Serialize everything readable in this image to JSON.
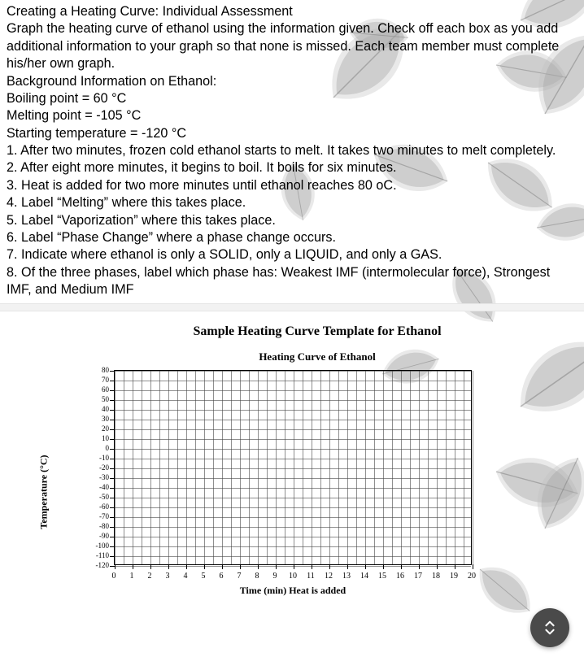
{
  "doc": {
    "title": "Creating a Heating Curve: Individual Assessment",
    "p1": "Graph the heating curve of ethanol using the information given. Check off each box as you add additional information to your graph so that none is missed. Each team member must complete his/her own graph.",
    "bg_heading": "Background Information on Ethanol:",
    "bp": "Boiling point = 60 °C",
    "mp": " Melting point = -105 °C",
    "st": " Starting temperature = -120 °C",
    "s1": "1. After two minutes, frozen cold ethanol starts to melt. It takes two minutes to melt completely.",
    "s2": "2. After eight more minutes, it begins to boil. It boils for six minutes.",
    "s3": "3. Heat is added for two more minutes until ethanol reaches 80 oC.",
    "s4": "4. Label “Melting” where this takes place.",
    "s5": "5. Label “Vaporization” where this takes place.",
    "s6": "6. Label “Phase Change” where a phase change occurs.",
    "s7": "7. Indicate where ethanol is only a SOLID, only a LIQUID, and only a GAS.",
    "s8": "8. Of the three phases, label which phase has: Weakest IMF (intermolecular force), Strongest IMF, and Medium IMF"
  },
  "chart": {
    "script_title": "Sample Heating Curve Template for Ethanol",
    "serif_title": "Heating Curve of Ethanol",
    "xlabel": "Time (min) Heat is added",
    "ylabel": "Temperature (°C)"
  },
  "chart_data": {
    "type": "line",
    "title": "Heating Curve of Ethanol",
    "xlabel": "Time (min) Heat is added",
    "ylabel": "Temperature (°C)",
    "x_ticks": [
      0,
      1,
      2,
      3,
      4,
      5,
      6,
      7,
      8,
      9,
      10,
      11,
      12,
      13,
      14,
      15,
      16,
      17,
      18,
      19,
      20
    ],
    "y_ticks": [
      80,
      70,
      60,
      50,
      40,
      30,
      20,
      10,
      0,
      -10,
      -20,
      -30,
      -40,
      -50,
      -60,
      -70,
      -80,
      -90,
      -100,
      -110,
      -120
    ],
    "xlim": [
      0,
      20
    ],
    "ylim": [
      -120,
      80
    ],
    "grid": true,
    "series": []
  }
}
